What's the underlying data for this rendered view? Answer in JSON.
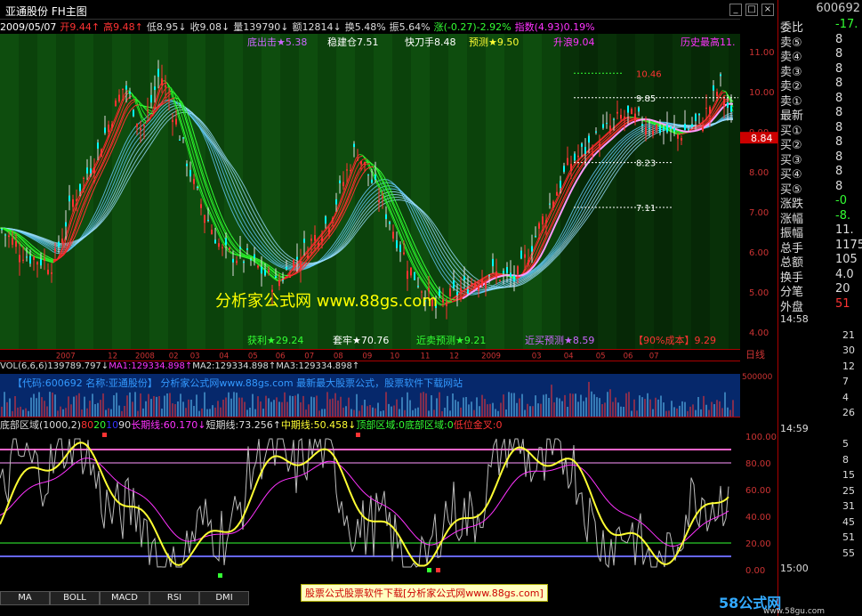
{
  "window": {
    "title": "亚通股份  FH主图"
  },
  "quote_line": [
    {
      "t": "2009/05/07",
      "c": "#fff"
    },
    {
      "t": "开9.44↑",
      "c": "#f33"
    },
    {
      "t": "高9.48↑",
      "c": "#f33"
    },
    {
      "t": "低8.95↓",
      "c": "#ddd"
    },
    {
      "t": "收9.08↓",
      "c": "#ddd"
    },
    {
      "t": "量139790↓",
      "c": "#ddd"
    },
    {
      "t": "额12814↓",
      "c": "#ddd"
    },
    {
      "t": "换5.48%",
      "c": "#ddd"
    },
    {
      "t": "振5.64%",
      "c": "#ddd"
    },
    {
      "t": "涨(-0.27)-2.92%",
      "c": "#3f3"
    },
    {
      "t": "指数(4.93)0.19%",
      "c": "#f3f"
    }
  ],
  "main_labels": [
    {
      "t": "底出击★5.38",
      "c": "#c6f"
    },
    {
      "t": "稳建仓7.51",
      "c": "#fff"
    },
    {
      "t": "快刀手8.48",
      "c": "#fff"
    },
    {
      "t": "预测★9.50",
      "c": "#ff3"
    },
    {
      "t": "升浪9.04",
      "c": "#f3f"
    },
    {
      "t": "历史最高11.",
      "c": "#f3f"
    }
  ],
  "bottom_labels": [
    {
      "t": "获利★29.24",
      "c": "#3f3"
    },
    {
      "t": "套牢★70.76",
      "c": "#fff"
    },
    {
      "t": "近卖预测★9.21",
      "c": "#3f3"
    },
    {
      "t": "近买预测★8.59",
      "c": "#c6f"
    },
    {
      "t": "【90%成本】9.29",
      "c": "#f33"
    }
  ],
  "price_levels": [
    {
      "t": "10.46",
      "c": "#f33"
    },
    {
      "t": "9.85",
      "c": "#fff"
    },
    {
      "t": "8.23",
      "c": "#fff"
    },
    {
      "t": "7.11",
      "c": "#fff"
    }
  ],
  "watermark": "分析家公式网 www.88gs.com",
  "price_axis": [
    "11.00",
    "10.00",
    "9.00",
    "8.00",
    "7.00",
    "6.00",
    "5.00",
    "4.00"
  ],
  "current_price": "8.84",
  "date_axis": [
    "2007",
    "12",
    "2008",
    "02",
    "03",
    "04",
    "05",
    "06",
    "07",
    "08",
    "09",
    "10",
    "11",
    "12",
    "2009",
    "03",
    "04",
    "05",
    "06",
    "07",
    "日线"
  ],
  "vol_info": [
    {
      "t": "VOL(6,6,6)",
      "c": "#ddd"
    },
    {
      "t": "139789.797↓",
      "c": "#ddd"
    },
    {
      "t": "MA1:129334.898↑",
      "c": "#f3f"
    },
    {
      "t": "MA2:129334.898↑",
      "c": "#ddd"
    },
    {
      "t": "MA3:129334.898↑",
      "c": "#ddd"
    }
  ],
  "vol_axis": "500000",
  "vol_caption": "【代码:600692 名称:亚通股份】      分析家公式网www.88gs.com 最新最大股票公式，股票软件下载网站",
  "ind_info": [
    {
      "t": "底部区域(1000,2)",
      "c": "#ddd"
    },
    {
      "t": "80",
      "c": "#f33"
    },
    {
      "t": "20",
      "c": "#3f3"
    },
    {
      "t": "10",
      "c": "#33f"
    },
    {
      "t": "90",
      "c": "#ddd"
    },
    {
      "t": "长期线:60.170↓",
      "c": "#f3f"
    },
    {
      "t": "短期线:73.256↑",
      "c": "#ddd"
    },
    {
      "t": "中期线:50.458↓",
      "c": "#ff3"
    },
    {
      "t": "顶部区域:0",
      "c": "#3f3"
    },
    {
      "t": "底部区域:0",
      "c": "#3f3"
    },
    {
      "t": "低位金叉:0",
      "c": "#f33"
    }
  ],
  "ind_axis": [
    "100.00",
    "80.00",
    "60.00",
    "40.00",
    "20.00",
    "0.00"
  ],
  "tabs": [
    "MA",
    "BOLL",
    "MACD",
    "RSI",
    "DMI"
  ],
  "banner": "股票公式股票软件下载[分析家公式网www.88gs.com]",
  "side_code": "600692",
  "side_rows": [
    {
      "l": "委比",
      "v": "-17.",
      "lc": "#ddd",
      "vc": "#3f3"
    },
    {
      "l": "卖⑤",
      "v": "8",
      "lc": "#ddd",
      "vc": "#ddd"
    },
    {
      "l": "卖④",
      "v": "8",
      "lc": "#ddd",
      "vc": "#ddd"
    },
    {
      "l": "卖③",
      "v": "8",
      "lc": "#ddd",
      "vc": "#ddd"
    },
    {
      "l": "卖②",
      "v": "8",
      "lc": "#ddd",
      "vc": "#ddd"
    },
    {
      "l": "卖①",
      "v": "8",
      "lc": "#ddd",
      "vc": "#ddd"
    },
    {
      "l": "最新",
      "v": "8",
      "lc": "#ddd",
      "vc": "#ddd"
    },
    {
      "l": "买①",
      "v": "8",
      "lc": "#ddd",
      "vc": "#ddd"
    },
    {
      "l": "买②",
      "v": "8",
      "lc": "#ddd",
      "vc": "#ddd"
    },
    {
      "l": "买③",
      "v": "8",
      "lc": "#ddd",
      "vc": "#ddd"
    },
    {
      "l": "买④",
      "v": "8",
      "lc": "#ddd",
      "vc": "#ddd"
    },
    {
      "l": "买⑤",
      "v": "8",
      "lc": "#ddd",
      "vc": "#ddd"
    },
    {
      "l": "涨跌",
      "v": "-0",
      "lc": "#ddd",
      "vc": "#3f3"
    },
    {
      "l": "涨幅",
      "v": "-8.",
      "lc": "#ddd",
      "vc": "#3f3"
    },
    {
      "l": "振幅",
      "v": "11.",
      "lc": "#ddd",
      "vc": "#ddd"
    },
    {
      "l": "总手",
      "v": "1175",
      "lc": "#ddd",
      "vc": "#ddd"
    },
    {
      "l": "总额",
      "v": "105",
      "lc": "#ddd",
      "vc": "#ddd"
    },
    {
      "l": "换手",
      "v": "4.0",
      "lc": "#ddd",
      "vc": "#ddd"
    },
    {
      "l": "分笔",
      "v": "20",
      "lc": "#ddd",
      "vc": "#ddd"
    },
    {
      "l": "外盘",
      "v": "51",
      "lc": "#ddd",
      "vc": "#f33"
    }
  ],
  "ticks": [
    {
      "l": "14:58",
      "v": ""
    },
    {
      "l": "",
      "v": "21"
    },
    {
      "l": "",
      "v": "30"
    },
    {
      "l": "",
      "v": "12"
    },
    {
      "l": "",
      "v": "7"
    },
    {
      "l": "",
      "v": "4"
    },
    {
      "l": "",
      "v": "26"
    },
    {
      "l": "14:59",
      "v": ""
    },
    {
      "l": "",
      "v": "5"
    },
    {
      "l": "",
      "v": "8"
    },
    {
      "l": "",
      "v": "15"
    },
    {
      "l": "",
      "v": "25"
    },
    {
      "l": "",
      "v": "31"
    },
    {
      "l": "",
      "v": "45"
    },
    {
      "l": "",
      "v": "51"
    },
    {
      "l": "",
      "v": "55"
    },
    {
      "l": "15:00",
      "v": ""
    }
  ],
  "logo": "58公式网",
  "logo_url": "www.58gu.com"
}
